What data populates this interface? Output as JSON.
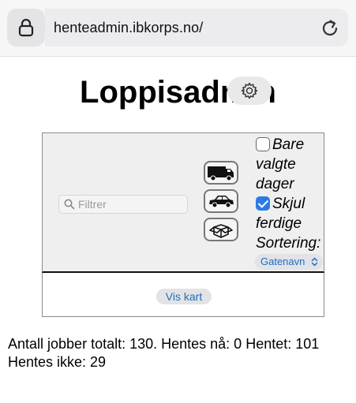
{
  "browser": {
    "url": "henteadmin.ibkorps.no/",
    "lock_icon": "lock-icon",
    "reload_icon": "reload-icon"
  },
  "page": {
    "title": "Loppisadmin",
    "settings_icon": "gear-icon"
  },
  "filters": {
    "search_placeholder": "Filtrer",
    "search_value": "",
    "vehicle_icons": [
      "truck-icon",
      "car-icon",
      "box-icon"
    ],
    "only_selected_days": {
      "label_lines": [
        "Bare",
        "valgte",
        "dager"
      ],
      "checked": false
    },
    "hide_finished": {
      "label_lines": [
        "Skjul",
        "ferdige"
      ],
      "checked": true
    },
    "sort_label": "Sortering:",
    "sort_value": "Gatenavn"
  },
  "map": {
    "button_label": "Vis kart"
  },
  "stats": {
    "line1": "Antall jobber totalt: 130. Hentes nå: 0 Hentet: 101",
    "line2": "Hentes ikke: 29"
  },
  "colors": {
    "accent": "#2c7be5",
    "link": "#1a6fc1",
    "panel_bg": "#efefef"
  }
}
